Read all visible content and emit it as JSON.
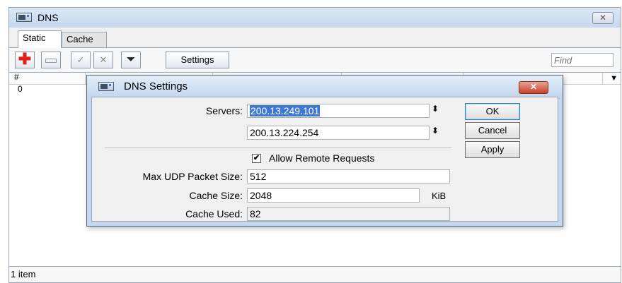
{
  "main_window": {
    "title": "DNS",
    "close_symbol": "✕",
    "tabs": [
      {
        "label": "Static",
        "active": true
      },
      {
        "label": "Cache",
        "active": false
      }
    ],
    "toolbar": {
      "add_symbol": "✚",
      "enable_symbol": "✓",
      "disable_symbol": "✕",
      "filter_symbol": "⏷",
      "settings_label": "Settings",
      "find_placeholder": "Find"
    },
    "list": {
      "columns": [
        "#"
      ],
      "rows": [
        {
          "index": "0"
        }
      ],
      "menu_symbol": "▼"
    },
    "status": "1 item"
  },
  "dialog": {
    "title": "DNS Settings",
    "close_symbol": "✕",
    "servers_label": "Servers:",
    "servers": [
      "200.13.249.101",
      "200.13.224.254"
    ],
    "spin_symbol": "⬍",
    "allow_remote_requests": {
      "label": "Allow Remote Requests",
      "checked": true,
      "check_symbol": "✔"
    },
    "max_udp_label": "Max UDP Packet Size:",
    "max_udp_value": "512",
    "cache_size_label": "Cache Size:",
    "cache_size_value": "2048",
    "cache_size_unit": "KiB",
    "cache_used_label": "Cache Used:",
    "cache_used_value": "82",
    "buttons": {
      "ok": "OK",
      "cancel": "Cancel",
      "apply": "Apply"
    }
  },
  "icons": [
    "window-icon",
    "add-icon",
    "remove-icon",
    "enable-icon",
    "disable-icon",
    "filter-icon",
    "close-icon",
    "spin-icon",
    "checkbox-check-icon"
  ],
  "colors": {
    "title_bar": "#c6d8ee",
    "selection": "#3c78d8",
    "add_red": "#e0201a",
    "close_red": "#c9412a"
  }
}
